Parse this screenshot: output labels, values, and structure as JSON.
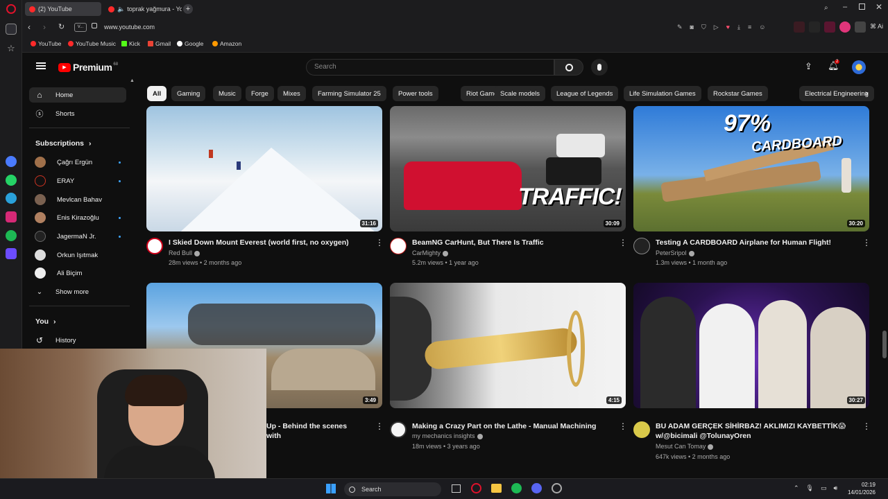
{
  "browser": {
    "tabs": [
      {
        "label": "(2) YouTube",
        "active": true
      },
      {
        "label": "toprak yağmura - You",
        "active": false
      }
    ],
    "address": "www.youtube.com",
    "address_prefix": "V...",
    "bookmarks": [
      "YouTube",
      "YouTube Music",
      "Kick",
      "Gmail",
      "Google",
      "Amazon"
    ],
    "ai_label": "Ai"
  },
  "youtube": {
    "logo_text": "Premium",
    "logo_sup": "68",
    "search_placeholder": "Search",
    "notifications_count": "2",
    "chips": [
      "All",
      "Gaming",
      "Music",
      "Forge",
      "Mixes",
      "Farming Simulator 25",
      "Power tools",
      "Riot Games",
      "Scale models",
      "League of Legends",
      "Life Simulation Games",
      "Rockstar Games",
      "Electrical Engineering"
    ],
    "sidebar": {
      "home": "Home",
      "shorts": "Shorts",
      "subscriptions_header": "Subscriptions",
      "subscriptions": [
        "Çağrı Ergün",
        "ERAY",
        "Mevlcan Bahav",
        "Enis Kirazoğlu",
        "JagermaN Jr.",
        "Orkun Işıtmak",
        "Ali Biçim"
      ],
      "show_more": "Show more",
      "you_header": "You",
      "history": "History"
    },
    "videos": [
      {
        "title": "I Skied Down Mount Everest (world first, no oxygen)",
        "channel": "Red Bull",
        "meta": "28m views • 2 months ago",
        "duration": "31:16"
      },
      {
        "title": "BeamNG CarHunt, But There Is Traffic",
        "channel": "CarMighty",
        "meta": "5.2m views • 1 year ago",
        "duration": "30:09"
      },
      {
        "title": "Testing A CARDBOARD Airplane for Human Flight!",
        "channel": "PeterSripol",
        "meta": "1.3m views • 1 month ago",
        "duration": "30:20"
      },
      {
        "title": "Up - Behind the scenes with",
        "channel": "",
        "meta": "",
        "duration": "3:49"
      },
      {
        "title": "Making a Crazy Part on the Lathe - Manual Machining",
        "channel": "my mechanics insights",
        "meta": "18m views • 3 years ago",
        "duration": "4:15"
      },
      {
        "title": "BU ADAM GERÇEK SİHİRBAZ! AKLIMIZI KAYBETTİK😱 w/@bicimali @TolunayOren",
        "channel": "Mesut Can Tomay",
        "meta": "647k views • 2 months ago",
        "duration": "30:27"
      }
    ],
    "thumb_texts": {
      "traffic": "TRAFFIC!",
      "cardboard_pct": "97%",
      "cardboard": "CARDBOARD"
    }
  },
  "taskbar": {
    "search": "Search",
    "time": "02:19",
    "date": "14/01/2026"
  },
  "colors": {
    "accent": "#ff0000",
    "chip_bg": "#272727",
    "bg": "#0f0f0f",
    "link": "#3ea6ff"
  }
}
